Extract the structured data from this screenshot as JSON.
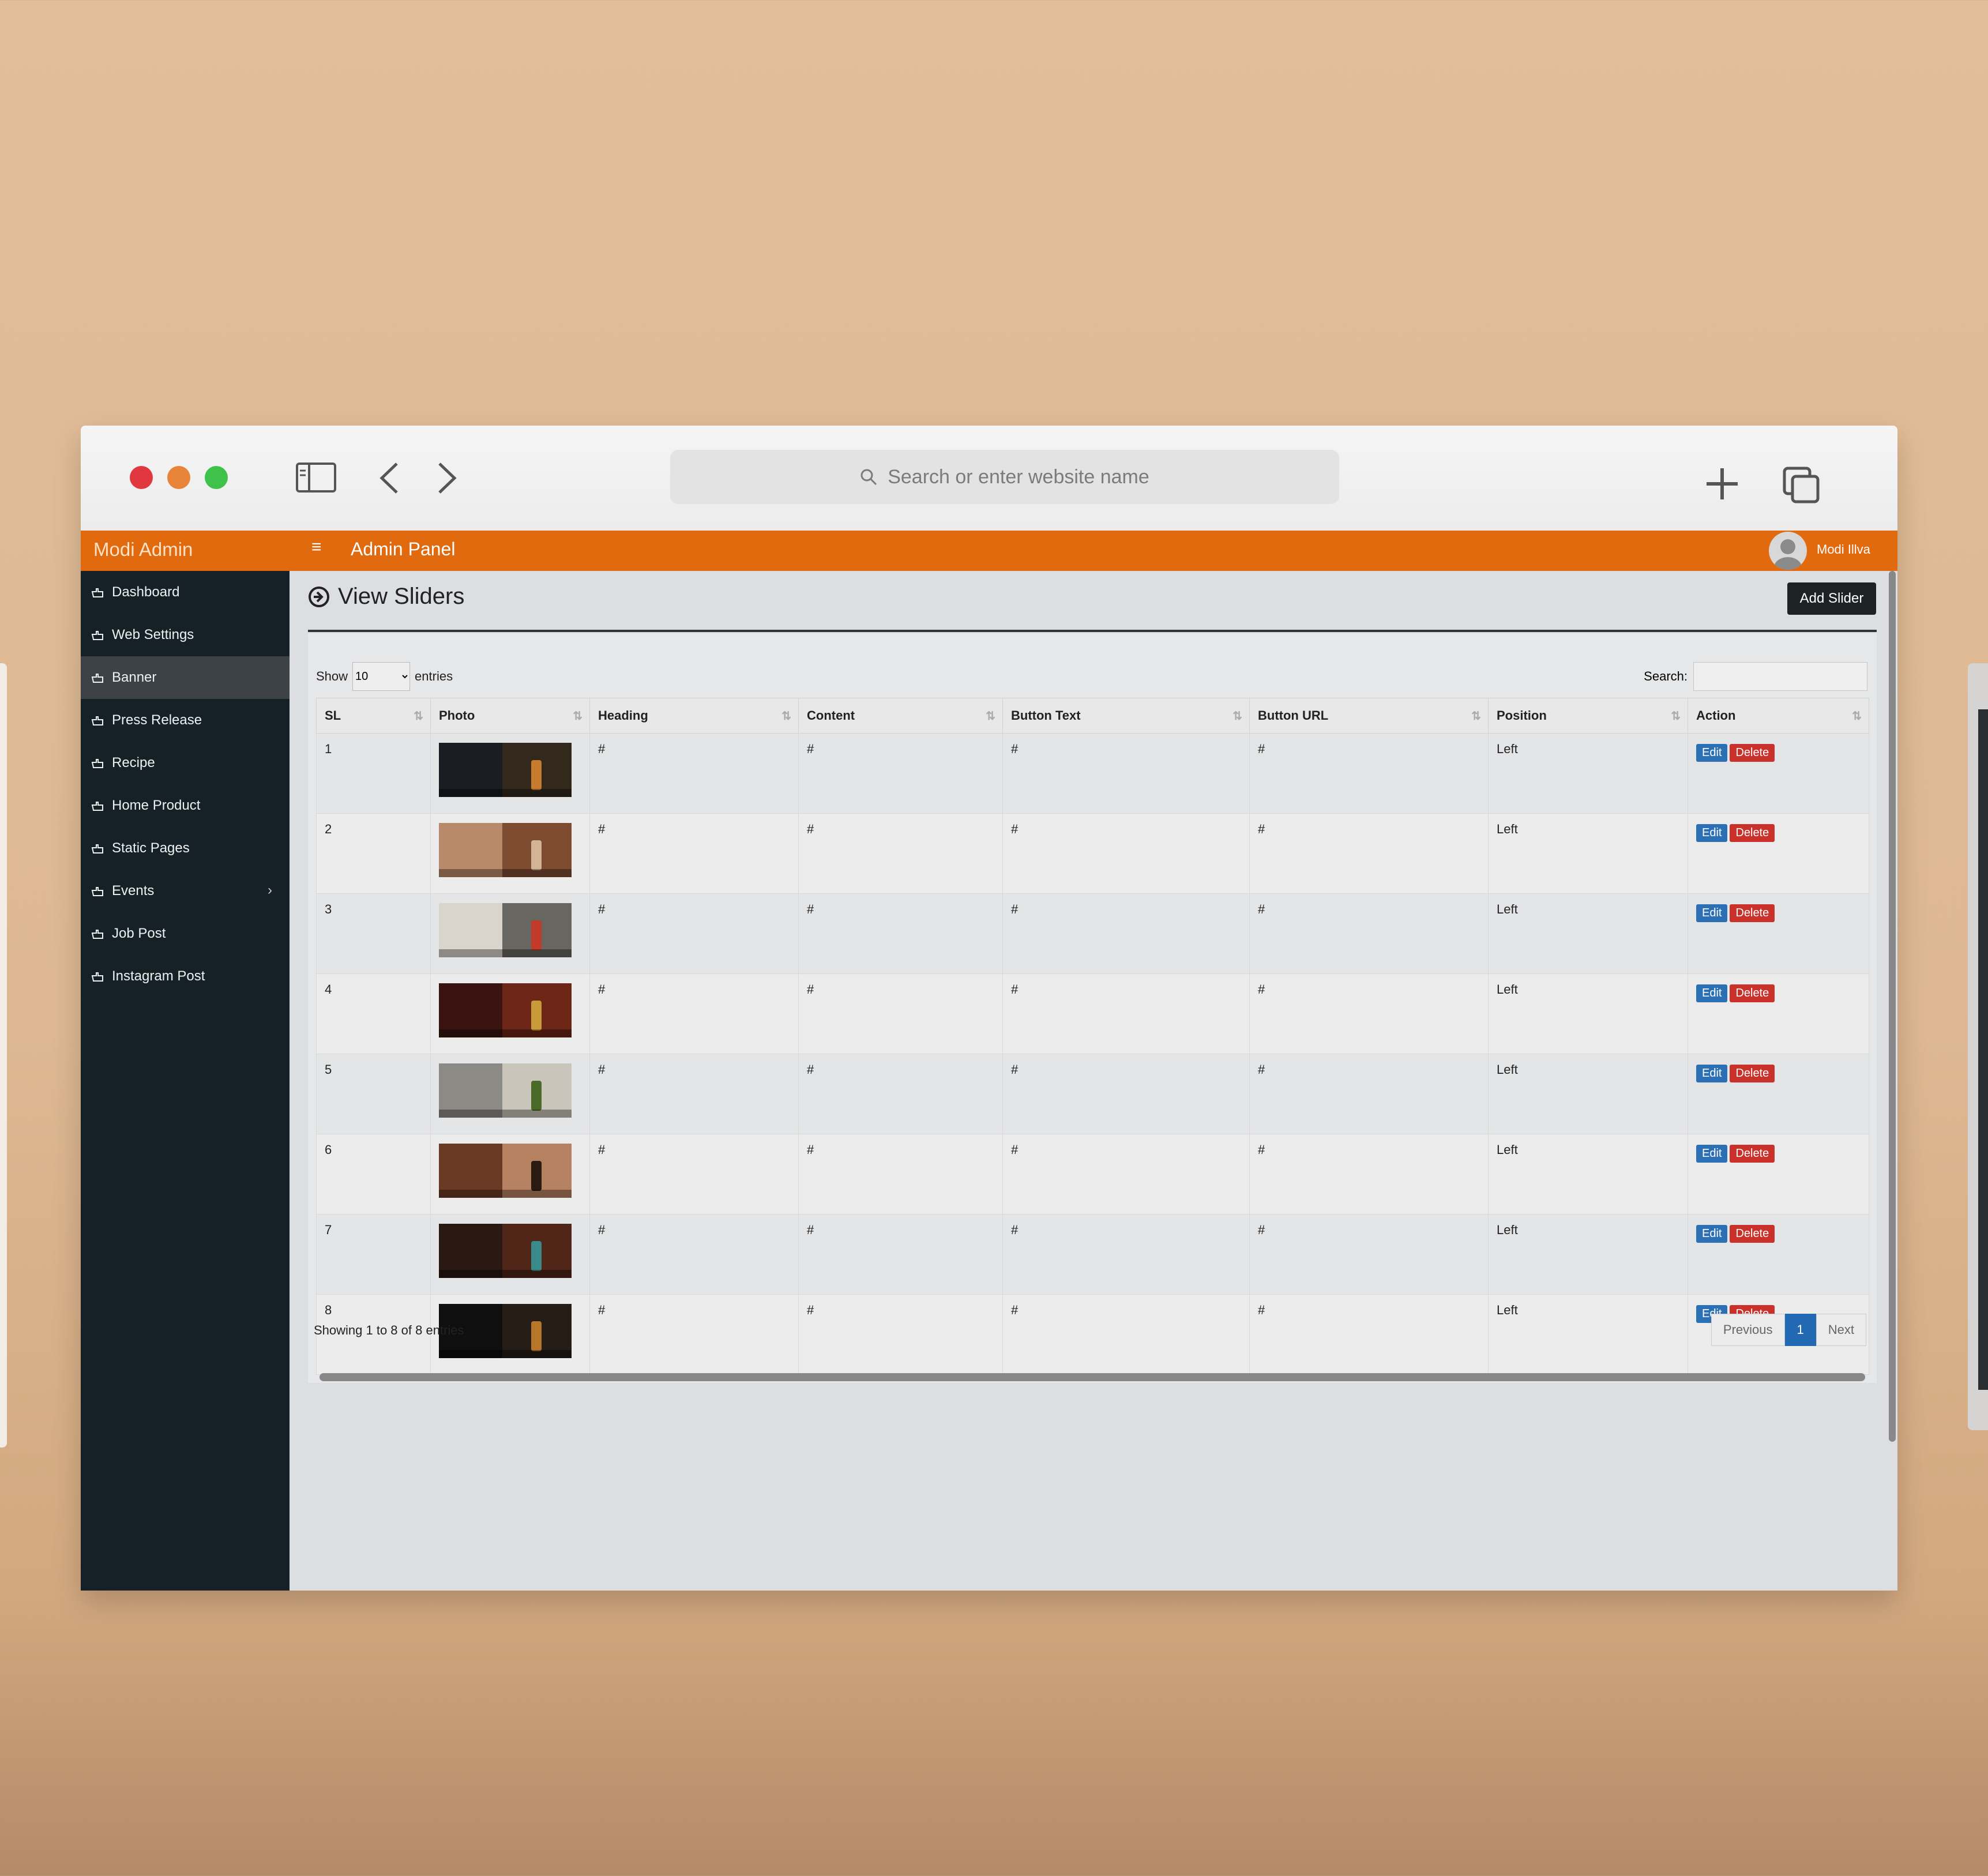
{
  "browser": {
    "url_placeholder": "Search or enter website name"
  },
  "topbar": {
    "brand": "Modi Admin",
    "hamburger": "≡",
    "title": "Admin Panel",
    "user_name": "Modi Illva"
  },
  "sidebar": {
    "items": [
      {
        "label": "Dashboard"
      },
      {
        "label": "Web Settings"
      },
      {
        "label": "Banner"
      },
      {
        "label": "Press Release"
      },
      {
        "label": "Recipe"
      },
      {
        "label": "Home Product"
      },
      {
        "label": "Static Pages"
      },
      {
        "label": "Events",
        "caret": "›"
      },
      {
        "label": "Job Post"
      },
      {
        "label": "Instagram Post"
      }
    ]
  },
  "main": {
    "title": "View Sliders",
    "add_button": "Add Slider",
    "show_label": "Show",
    "show_value": "10",
    "entries_label": "entries",
    "search_label": "Search:",
    "info": "Showing 1 to 8 of 8 entries",
    "pager": {
      "previous": "Previous",
      "current": "1",
      "next": "Next"
    }
  },
  "table": {
    "columns": [
      "SL",
      "Photo",
      "Heading",
      "Content",
      "Button Text",
      "Button URL",
      "Position",
      "Action"
    ],
    "edit_label": "Edit",
    "delete_label": "Delete",
    "rows": [
      {
        "sl": "1",
        "heading": "#",
        "content": "#",
        "button_text": "#",
        "button_url": "#",
        "position": "Left",
        "thumb": [
          "#1a1e22",
          "#3a2a1c",
          "#c77b2e"
        ]
      },
      {
        "sl": "2",
        "heading": "#",
        "content": "#",
        "button_text": "#",
        "button_url": "#",
        "position": "Left",
        "thumb": [
          "#b98a6a",
          "#6e3b22",
          "#d4b497"
        ]
      },
      {
        "sl": "3",
        "heading": "#",
        "content": "#",
        "button_text": "#",
        "button_url": "#",
        "position": "Left",
        "thumb": [
          "#d9d4cc",
          "#4a4a46",
          "#c23a2a"
        ]
      },
      {
        "sl": "4",
        "heading": "#",
        "content": "#",
        "button_text": "#",
        "button_url": "#",
        "position": "Left",
        "thumb": [
          "#3a1410",
          "#7a2a18",
          "#c99a3a"
        ]
      },
      {
        "sl": "5",
        "heading": "#",
        "content": "#",
        "button_text": "#",
        "button_url": "#",
        "position": "Left",
        "thumb": [
          "#8c8a84",
          "#d9d3c8",
          "#4a6a2a"
        ]
      },
      {
        "sl": "6",
        "heading": "#",
        "content": "#",
        "button_text": "#",
        "button_url": "#",
        "position": "Left",
        "thumb": [
          "#6a3a24",
          "#c99370",
          "#2a1a12"
        ]
      },
      {
        "sl": "7",
        "heading": "#",
        "content": "#",
        "button_text": "#",
        "button_url": "#",
        "position": "Left",
        "thumb": [
          "#2a1812",
          "#5a2a1a",
          "#3a8a8a"
        ]
      },
      {
        "sl": "8",
        "heading": "#",
        "content": "#",
        "button_text": "#",
        "button_url": "#",
        "position": "Left",
        "thumb": [
          "#0f0f10",
          "#2a2018",
          "#b8762a"
        ]
      }
    ]
  },
  "colors": {
    "topbar": "#e06a0d",
    "sidebar": "#152126",
    "edit": "#2b70b5",
    "delete": "#c9312a",
    "pager_active": "#2169b3"
  }
}
